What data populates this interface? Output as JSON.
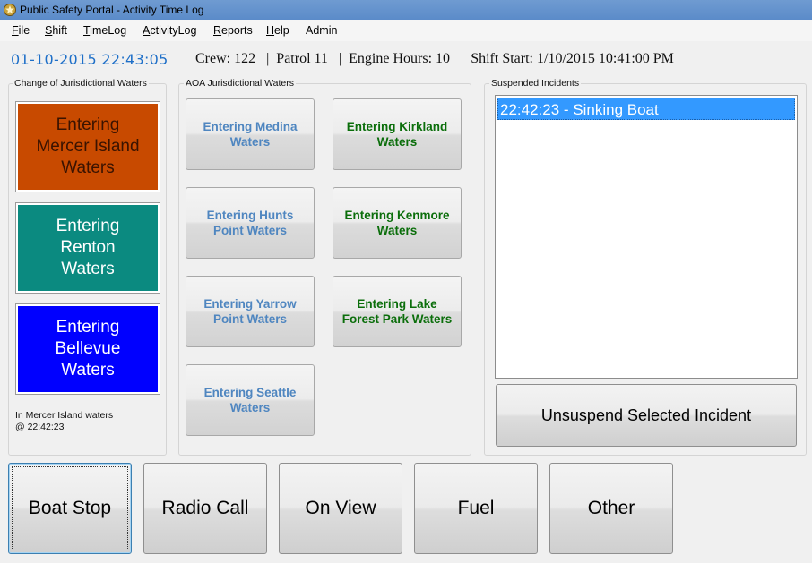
{
  "window": {
    "title": "Public Safety Portal - Activity Time Log"
  },
  "menu": [
    {
      "label": "File",
      "key": "F",
      "rest": "ile"
    },
    {
      "label": "Shift",
      "key": "S",
      "rest": "hift"
    },
    {
      "label": "TimeLog",
      "key": "T",
      "rest": "imeLog"
    },
    {
      "label": "ActivityLog",
      "key": "A",
      "rest": "ctivityLog"
    },
    {
      "label": "Reports",
      "key": "R",
      "rest": "eports"
    },
    {
      "label": "Help",
      "key": "H",
      "rest": "elp"
    },
    {
      "label": "Admin",
      "key": "",
      "rest": "Admin"
    }
  ],
  "header": {
    "datetime": "01-10-2015 22:43:05",
    "status": "Crew: 122   |  Patrol 11   |  Engine Hours: 10   |  Shift Start: 1/10/2015 10:41:00 PM"
  },
  "jurisdiction": {
    "label": "Change of Jurisdictional Waters",
    "buttons": [
      {
        "text": "Entering Mercer Island Waters",
        "bg": "#c84a00",
        "fg": "#3a1300"
      },
      {
        "text": "Entering Renton Waters",
        "bg": "#0b8a80",
        "fg": "#ffffff"
      },
      {
        "text": "Entering Bellevue Waters",
        "bg": "#0000ff",
        "fg": "#ffffff"
      }
    ],
    "status_line1": "In Mercer Island waters",
    "status_line2": "@ 22:42:23"
  },
  "aoa": {
    "label": "AOA Jurisdictional Waters",
    "buttons": [
      {
        "text": "Entering Medina Waters",
        "state": "disabled"
      },
      {
        "text": "Entering Kirkland Waters",
        "state": "enabled"
      },
      {
        "text": "Entering Hunts Point Waters",
        "state": "disabled"
      },
      {
        "text": "Entering Kenmore Waters",
        "state": "enabled"
      },
      {
        "text": "Entering Yarrow Point Waters",
        "state": "disabled"
      },
      {
        "text": "Entering Lake Forest Park Waters",
        "state": "enabled"
      },
      {
        "text": "Entering Seattle Waters",
        "state": "disabled"
      }
    ]
  },
  "suspended": {
    "label": "Suspended Incidents",
    "items": [
      "22:42:23 - Sinking Boat"
    ],
    "unsuspend_label": "Unsuspend Selected Incident"
  },
  "actions": [
    "Boat Stop",
    "Radio Call",
    "On View",
    "Fuel",
    "Other"
  ],
  "colors": {
    "disabled_text": "#4f86c0",
    "enabled_text": "#0b6e0b",
    "selection": "#3399ff",
    "datetime": "#1e6fc8"
  }
}
